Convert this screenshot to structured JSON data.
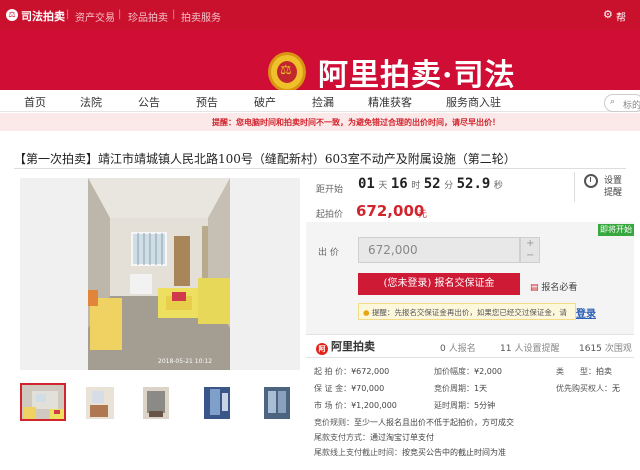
{
  "topbar": {
    "brand": "司法拍卖",
    "links": [
      "资产交易",
      "珍品拍卖",
      "拍卖服务"
    ],
    "right_label": "帮"
  },
  "header": {
    "logo_text": "阿里拍卖·司法"
  },
  "nav": {
    "items": [
      "首页",
      "法院",
      "公告",
      "预告",
      "破产",
      "捡漏",
      "精准获客",
      "服务商入驻"
    ],
    "search_placeholder": "标的"
  },
  "notice": "提醒：您电脑时间和拍卖时间不一致，为避免错过合理的出价时间，请尽早出价！",
  "item": {
    "title": "【第一次拍卖】靖江市靖城镇人民北路100号（缝配新村）603室不动产及附属设施（第二轮）",
    "countdown_label": "距开始",
    "countdown": {
      "days": "01",
      "d_unit": "天",
      "hours": "16",
      "h_unit": "时",
      "minutes": "52",
      "m_unit": "分",
      "seconds": "52.9",
      "s_unit": "秒"
    },
    "price_label": "起拍价",
    "price": "672,000",
    "price_unit": "元",
    "remind_label_1": "设置",
    "remind_label_2": "提醒",
    "status_tag": "即将开始",
    "bid_label": "出 价",
    "bid_value": "672,000",
    "signup_button": "(您未登录) 报名交保证金",
    "must_read": "报名必看",
    "hint_prefix": "提醒：",
    "hint_text": "先报名交保证金再出价，如果您已经交过保证金，请",
    "login_link": "登录",
    "photo_caption": "2018-05-21 10:12"
  },
  "stats": {
    "logo": "阿里拍卖",
    "signup_count": "0",
    "signup_label": "人报名",
    "remind_count": "11",
    "remind_label": "人设置提醒",
    "view_count": "1615",
    "view_label": "次围观"
  },
  "details": {
    "start_price_label": "起 拍 价：",
    "start_price": "¥672,000",
    "increment_label": "加价幅度：",
    "increment": "¥2,000",
    "type_label": "类　　型：",
    "type": "拍卖",
    "deposit_label": "保 证 金：",
    "deposit": "¥70,000",
    "period_label": "竞价周期：",
    "period": "1天",
    "priority_label": "优先购买权人：",
    "priority": "无",
    "market_label": "市 场 价：",
    "market": "¥1,200,000",
    "delay_label": "延时周期：",
    "delay": "5分钟",
    "rule_label": "竞价规则：",
    "rule": "至少一人报名且出价不低于起拍价，方可成交",
    "pay_label": "尾款支付方式：",
    "pay": "通过淘宝订单支付",
    "deadline_label": "尾款线上支付截止时间：",
    "deadline": "按竞买公告中的截止时间为准"
  },
  "colors": {
    "brand_red": "#c9102c",
    "price_red": "#d2242d",
    "status_green": "#37a83e"
  }
}
